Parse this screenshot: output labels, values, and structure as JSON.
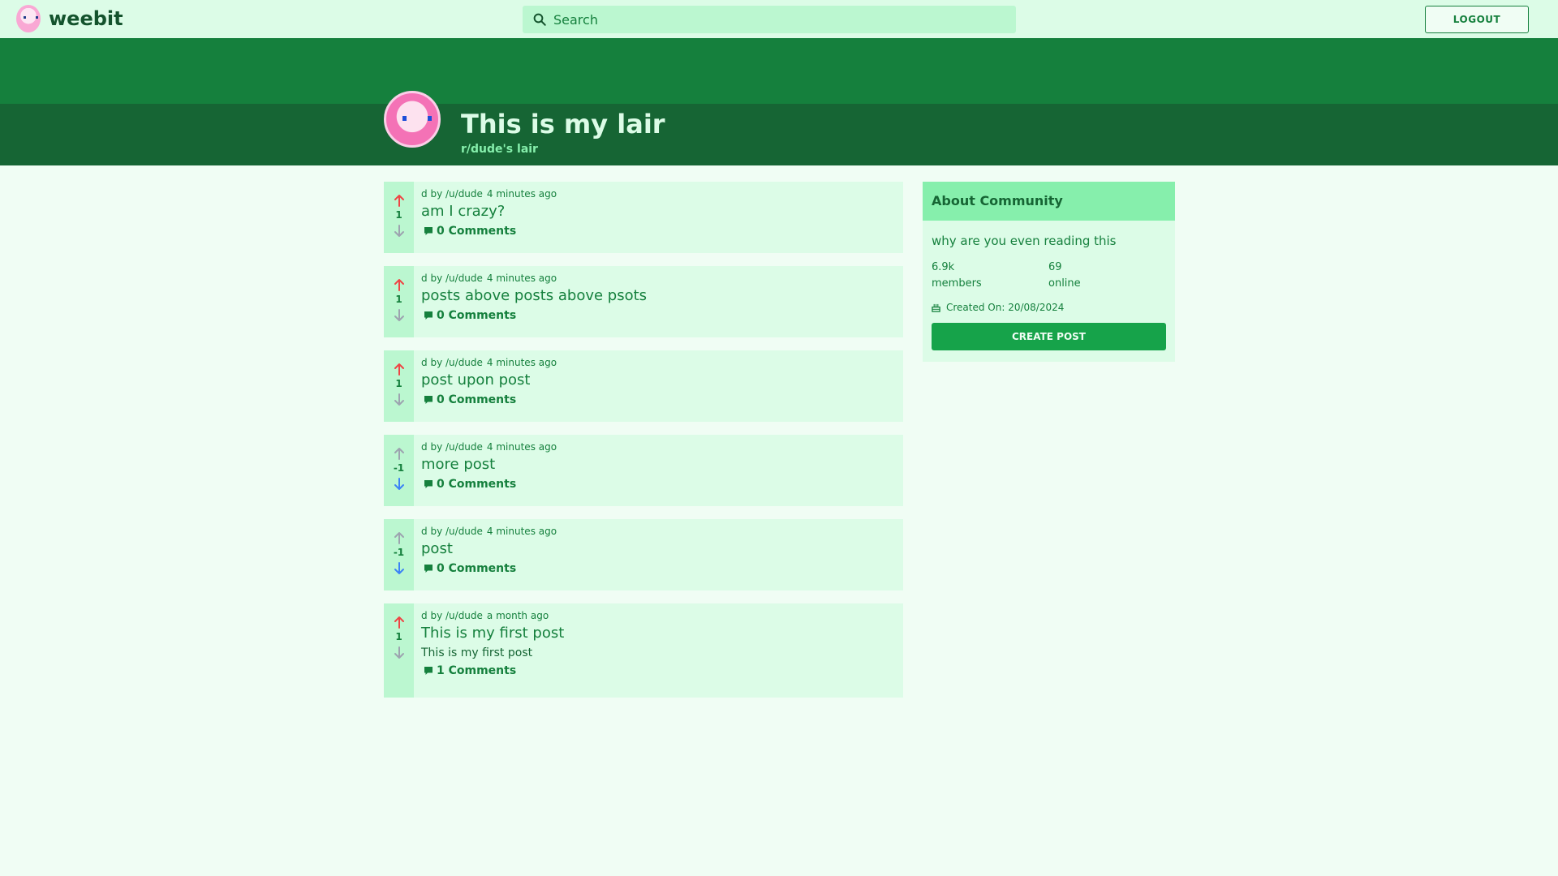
{
  "app": {
    "name": "weebit"
  },
  "search": {
    "placeholder": "Search"
  },
  "nav": {
    "logout_label": "LOGOUT"
  },
  "community": {
    "title": "This is my lair",
    "subtitle": "r/dude's lair"
  },
  "posts": [
    {
      "community": "d",
      "by": "by",
      "author": "/u/dude",
      "time": "4 minutes ago",
      "title": "am I crazy?",
      "body": "",
      "score": "1",
      "vote": "up",
      "comments": "0 Comments"
    },
    {
      "community": "d",
      "by": "by",
      "author": "/u/dude",
      "time": "4 minutes ago",
      "title": "posts above posts above psots",
      "body": "",
      "score": "1",
      "vote": "up",
      "comments": "0 Comments"
    },
    {
      "community": "d",
      "by": "by",
      "author": "/u/dude",
      "time": "4 minutes ago",
      "title": "post upon post",
      "body": "",
      "score": "1",
      "vote": "up",
      "comments": "0 Comments"
    },
    {
      "community": "d",
      "by": "by",
      "author": "/u/dude",
      "time": "4 minutes ago",
      "title": "more post",
      "body": "",
      "score": "-1",
      "vote": "down",
      "comments": "0 Comments"
    },
    {
      "community": "d",
      "by": "by",
      "author": "/u/dude",
      "time": "4 minutes ago",
      "title": "post",
      "body": "",
      "score": "-1",
      "vote": "down",
      "comments": "0 Comments"
    },
    {
      "community": "d",
      "by": "by",
      "author": "/u/dude",
      "time": "a month ago",
      "title": "This is my first post",
      "body": "This is my first post",
      "score": "1",
      "vote": "up",
      "comments": "1 Comments"
    }
  ],
  "about": {
    "header": "About Community",
    "description": "why are you even reading this",
    "members_count": "6.9k",
    "members_label": "members",
    "online_count": "69",
    "online_label": "online",
    "created": "Created On: 20/08/2024",
    "create_post_label": "CREATE POST"
  },
  "icons": {
    "search": "search-icon",
    "upvote": "arrow-up-icon",
    "downvote": "arrow-down-icon",
    "comment": "comment-icon",
    "cake": "cake-icon"
  },
  "colors": {
    "upvote_active": "#ef4444",
    "downvote_active": "#3b82f6",
    "vote_inactive": "#9ca3af",
    "brand_dark": "#166534",
    "brand": "#15803d"
  }
}
